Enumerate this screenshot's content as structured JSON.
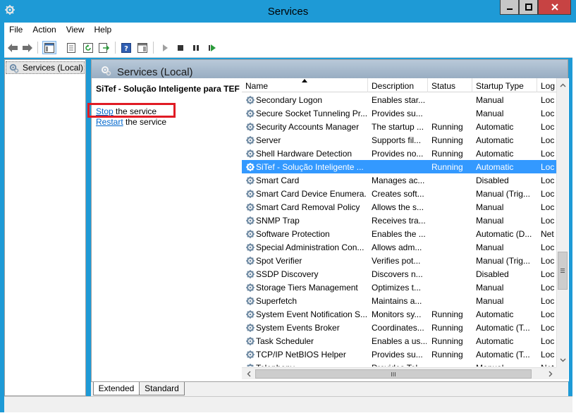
{
  "window": {
    "title": "Services"
  },
  "menu": [
    "File",
    "Action",
    "View",
    "Help"
  ],
  "tree": {
    "root_label": "Services (Local)"
  },
  "main": {
    "header_title": "Services (Local)",
    "service_name": "SiTef - Solução Inteligente para TEF",
    "stop_link": "Stop",
    "stop_suffix": " the service",
    "restart_link": "Restart",
    "restart_suffix": " the service"
  },
  "list": {
    "columns": [
      "Name",
      "Description",
      "Status",
      "Startup Type",
      "Log"
    ],
    "rows": [
      {
        "name": "Secondary Logon",
        "description": "Enables star...",
        "status": "",
        "startup": "Manual",
        "log": "Loc"
      },
      {
        "name": "Secure Socket Tunneling Pr...",
        "description": "Provides su...",
        "status": "",
        "startup": "Manual",
        "log": "Loc"
      },
      {
        "name": "Security Accounts Manager",
        "description": "The startup ...",
        "status": "Running",
        "startup": "Automatic",
        "log": "Loc"
      },
      {
        "name": "Server",
        "description": "Supports fil...",
        "status": "Running",
        "startup": "Automatic",
        "log": "Loc"
      },
      {
        "name": "Shell Hardware Detection",
        "description": "Provides no...",
        "status": "Running",
        "startup": "Automatic",
        "log": "Loc"
      },
      {
        "name": "SiTef - Solução Inteligente ...",
        "description": "",
        "status": "Running",
        "startup": "Automatic",
        "log": "Loc",
        "selected": true
      },
      {
        "name": "Smart Card",
        "description": "Manages ac...",
        "status": "",
        "startup": "Disabled",
        "log": "Loc"
      },
      {
        "name": "Smart Card Device Enumera...",
        "description": "Creates soft...",
        "status": "",
        "startup": "Manual (Trig...",
        "log": "Loc"
      },
      {
        "name": "Smart Card Removal Policy",
        "description": "Allows the s...",
        "status": "",
        "startup": "Manual",
        "log": "Loc"
      },
      {
        "name": "SNMP Trap",
        "description": "Receives tra...",
        "status": "",
        "startup": "Manual",
        "log": "Loc"
      },
      {
        "name": "Software Protection",
        "description": "Enables the ...",
        "status": "",
        "startup": "Automatic (D...",
        "log": "Net"
      },
      {
        "name": "Special Administration Con...",
        "description": "Allows adm...",
        "status": "",
        "startup": "Manual",
        "log": "Loc"
      },
      {
        "name": "Spot Verifier",
        "description": "Verifies pot...",
        "status": "",
        "startup": "Manual (Trig...",
        "log": "Loc"
      },
      {
        "name": "SSDP Discovery",
        "description": "Discovers n...",
        "status": "",
        "startup": "Disabled",
        "log": "Loc"
      },
      {
        "name": "Storage Tiers Management",
        "description": "Optimizes t...",
        "status": "",
        "startup": "Manual",
        "log": "Loc"
      },
      {
        "name": "Superfetch",
        "description": "Maintains a...",
        "status": "",
        "startup": "Manual",
        "log": "Loc"
      },
      {
        "name": "System Event Notification S...",
        "description": "Monitors sy...",
        "status": "Running",
        "startup": "Automatic",
        "log": "Loc"
      },
      {
        "name": "System Events Broker",
        "description": "Coordinates...",
        "status": "Running",
        "startup": "Automatic (T...",
        "log": "Loc"
      },
      {
        "name": "Task Scheduler",
        "description": "Enables a us...",
        "status": "Running",
        "startup": "Automatic",
        "log": "Loc"
      },
      {
        "name": "TCP/IP NetBIOS Helper",
        "description": "Provides su...",
        "status": "Running",
        "startup": "Automatic (T...",
        "log": "Loc"
      },
      {
        "name": "Telephony",
        "description": "Provides Tel...",
        "status": "",
        "startup": "Manual",
        "log": "Net"
      }
    ]
  },
  "tabs": [
    "Extended",
    "Standard"
  ],
  "colors": {
    "accent": "#1e9ad6",
    "selection": "#3399ff",
    "link": "#0066cc",
    "highlight": "#e01b24"
  }
}
